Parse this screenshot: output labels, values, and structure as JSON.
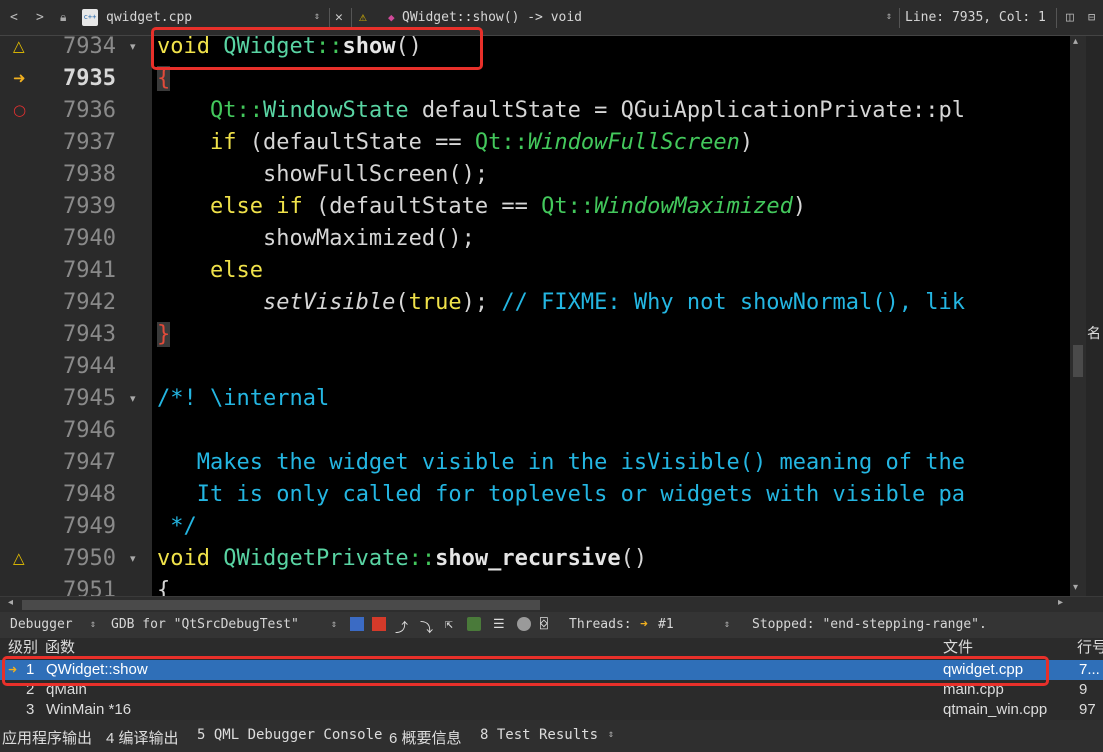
{
  "toolbar": {
    "file_name": "qwidget.cpp",
    "function_crumb": "QWidget::show() -> void",
    "cursor_pos": "Line: 7935, Col: 1"
  },
  "editor": {
    "lines": [
      {
        "num": "7934",
        "fold": "▾",
        "marker": "warning"
      },
      {
        "num": "7935",
        "fold": "",
        "marker": "current"
      },
      {
        "num": "7936",
        "fold": "",
        "marker": "breakpoint"
      },
      {
        "num": "7937",
        "fold": "",
        "marker": ""
      },
      {
        "num": "7938",
        "fold": "",
        "marker": ""
      },
      {
        "num": "7939",
        "fold": "",
        "marker": ""
      },
      {
        "num": "7940",
        "fold": "",
        "marker": ""
      },
      {
        "num": "7941",
        "fold": "",
        "marker": ""
      },
      {
        "num": "7942",
        "fold": "",
        "marker": ""
      },
      {
        "num": "7943",
        "fold": "",
        "marker": ""
      },
      {
        "num": "7944",
        "fold": "",
        "marker": ""
      },
      {
        "num": "7945",
        "fold": "▾",
        "marker": ""
      },
      {
        "num": "7946",
        "fold": "",
        "marker": ""
      },
      {
        "num": "7947",
        "fold": "",
        "marker": ""
      },
      {
        "num": "7948",
        "fold": "",
        "marker": ""
      },
      {
        "num": "7949",
        "fold": "",
        "marker": ""
      },
      {
        "num": "7950",
        "fold": "▾",
        "marker": "warning"
      },
      {
        "num": "7951",
        "fold": "",
        "marker": ""
      }
    ],
    "code": {
      "void": "void",
      "qwidget_cls": "QWidget",
      "scope": "::",
      "show_fn": "show",
      "parens": "()",
      "open_brace": "{",
      "close_brace": "}",
      "qt": "Qt",
      "window_state": "WindowState",
      "l36_rest": " defaultState = QGuiApplicationPrivate::pl",
      "if_kw": "if",
      "l37_mid": " (defaultState == ",
      "full_screen": "WindowFullScreen",
      "close_paren": ")",
      "l38": "showFullScreen();",
      "else_kw": "else",
      "l39_mid": " (defaultState == ",
      "maximized": "WindowMaximized",
      "l40": "showMaximized();",
      "set_visible": "setVisible",
      "true_kw": "true",
      "l42_sep": "); ",
      "l42_comment": "// FIXME: Why not showNormal(), lik",
      "l45": "/*! \\internal",
      "l47": "Makes the widget visible in the isVisible() meaning of the",
      "l48": "It is only called for toplevels or widgets with visible pa",
      "l49": " */",
      "qwp_cls": "QWidgetPrivate",
      "show_rec_fn": "show_recursive",
      "right_glyph": "名"
    }
  },
  "debugger": {
    "mode": "Debugger",
    "engine": "GDB for \"QtSrcDebugTest\"",
    "threads_label": "Threads:",
    "thread_value": "#1",
    "status": "Stopped: \"end-stepping-range\"."
  },
  "stack": {
    "headers": {
      "level": "级别",
      "function": "函数",
      "file": "文件",
      "line": "行号"
    },
    "rows": [
      {
        "level": "1",
        "function": "QWidget::show",
        "file": "qwidget.cpp",
        "line": "7..."
      },
      {
        "level": "2",
        "function": "qMain",
        "file": "main.cpp",
        "line": "9"
      },
      {
        "level": "3",
        "function": "WinMain *16",
        "file": "qtmain_win.cpp",
        "line": "97"
      }
    ]
  },
  "output_tabs": [
    "应用程序输出",
    "4 编译输出",
    "5 QML Debugger Console",
    "6 概要信息",
    "8 Test Results"
  ],
  "colors": {
    "highlight_box": "#e8302a",
    "selection": "#2f6fb8",
    "keyword": "#f0e24a",
    "type": "#59d4a3",
    "comment": "#24b6e2"
  }
}
